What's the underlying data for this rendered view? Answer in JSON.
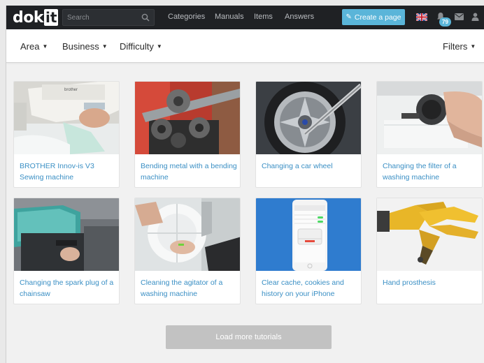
{
  "header": {
    "logo_text": "dok",
    "logo_box": "it",
    "search_placeholder": "Search",
    "nav": [
      "Categories",
      "Manuals",
      "Items",
      "Answers"
    ],
    "create_label": "Create a page",
    "notification_count": "79"
  },
  "filters": {
    "area": "Area",
    "business": "Business",
    "difficulty": "Difficulty",
    "filters": "Filters"
  },
  "tutorials": [
    {
      "title": "BROTHER Innov-is V3 Sewing machine"
    },
    {
      "title": "Bending metal with a bending machine"
    },
    {
      "title": "Changing a car wheel"
    },
    {
      "title": "Changing the filter of a washing machine"
    },
    {
      "title": "Changing the spark plug of a chainsaw"
    },
    {
      "title": "Cleaning the agitator of a washing machine"
    },
    {
      "title": "Clear cache, cookies and history on your iPhone"
    },
    {
      "title": "Hand prosthesis"
    }
  ],
  "load_more_label": "Load more tutorials",
  "colors": {
    "topbar": "#1f2124",
    "accent": "#5ab5d9",
    "link": "#3a8fc4",
    "load_button": "#c2c2c2"
  }
}
